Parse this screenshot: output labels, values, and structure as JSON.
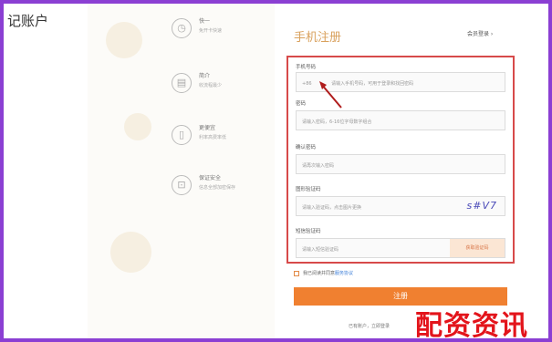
{
  "page": {
    "title": "记账户"
  },
  "features": [
    {
      "icon": "clock-icon",
      "title": "快一",
      "desc": "免开卡快速"
    },
    {
      "icon": "doc-icon",
      "title": "简介",
      "desc": "收流程最少"
    },
    {
      "icon": "phone-icon",
      "title": "更便宜",
      "desc": "利率高费率低"
    },
    {
      "icon": "lock-icon",
      "title": "保证安全",
      "desc": "信息全部加密保存"
    }
  ],
  "register": {
    "title": "手机注册",
    "login_link": "会员登录 ›"
  },
  "form": {
    "phone_label": "手机号码",
    "phone_prefix": "+86",
    "phone_placeholder": "请输入手机号码，可用于登录和找回密码",
    "password_label": "密码",
    "password_placeholder": "请输入密码，6-16位字母数字组合",
    "confirm_label": "确认密码",
    "confirm_placeholder": "请再次输入密码",
    "captcha_label": "图形验证码",
    "captcha_placeholder": "请输入验证码，点击图片更换",
    "captcha_text": "s#V7",
    "sms_label": "短信验证码",
    "sms_placeholder": "请输入短信验证码",
    "sms_button": "获取验证码"
  },
  "agree": {
    "text": "我已阅读并同意",
    "link": "服务协议"
  },
  "submit": "注册",
  "bottom": "已有账户，立即登录",
  "watermark": "配资资讯"
}
